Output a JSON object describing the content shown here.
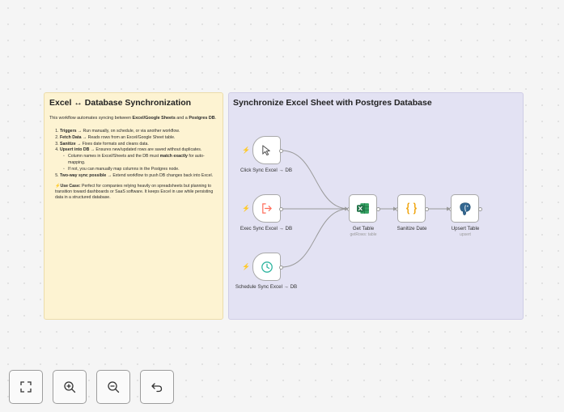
{
  "note_yellow": {
    "title": "Excel ↔ Database Synchronization",
    "intro_prefix": "This workflow automates syncing between ",
    "intro_bold1": "Excel/Google Sheets",
    "intro_mid": " and a ",
    "intro_bold2": "Postgres DB",
    "intro_suffix": ".",
    "steps": [
      {
        "bold": "Triggers",
        "text": " → Run manually, on schedule, or via another workflow."
      },
      {
        "bold": "Fetch Data",
        "text": " → Reads rows from an Excel/Google Sheet table."
      },
      {
        "bold": "Sanitize",
        "text": " → Fixes date formats and cleans data."
      },
      {
        "bold": "Upsert into DB",
        "text": " → Ensures new/updated rows are saved without duplicates."
      },
      {
        "bold": "Two-way sync possible",
        "text": " → Extend workflow to push DB changes back into Excel."
      }
    ],
    "sub1_prefix": "Column names in Excel/Sheets and the DB must ",
    "sub1_bold": "match exactly",
    "sub1_suffix": " for auto-mapping.",
    "sub2": "If not, you can manually map columns in the Postgres node.",
    "usecase_icon": "⚡",
    "usecase_bold": "Use Case:",
    "usecase_text": " Perfect for companies relying heavily on spreadsheets but planning to transition toward dashboards or SaaS software. It keeps Excel in use while persisting data in a structured database."
  },
  "note_purple": {
    "title": "Synchronize Excel Sheet with Postgres Database"
  },
  "nodes": {
    "click": {
      "label": "Click Sync Excel → DB",
      "icon": "cursor-icon"
    },
    "exec": {
      "label": "Exec Sync Excel → DB",
      "icon": "sign-in-icon"
    },
    "schedule": {
      "label": "Schedule Sync Excel → DB",
      "icon": "clock-icon"
    },
    "get_table": {
      "label": "Get Table",
      "sub": "getRows: table",
      "icon": "excel-icon"
    },
    "sanitize": {
      "label": "Sanitize Date",
      "icon": "code-braces-icon"
    },
    "upsert": {
      "label": "Upsert Table",
      "sub": "upsert",
      "icon": "postgres-icon"
    }
  },
  "colors": {
    "trigger_bolt": "#ff6d5a",
    "excel_green": "#1e7145",
    "code_orange": "#f0a30a",
    "postgres_blue": "#336791",
    "schedule_teal": "#2fb5a0"
  },
  "controls": {
    "fit": "fit-view-icon",
    "zoom_in": "zoom-in-icon",
    "zoom_out": "zoom-out-icon",
    "undo": "undo-icon"
  }
}
